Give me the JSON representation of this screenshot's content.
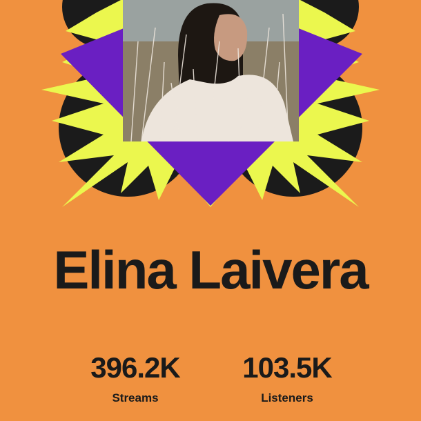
{
  "theme": {
    "background": "#F0913F",
    "text": "#1A1A1A",
    "burst_black": "#1B1B1B",
    "burst_yellow": "#EBF74E",
    "burst_purple": "#6A1FC2",
    "photo_sky": "#9AA2A0",
    "photo_field": "#8B7F67",
    "photo_dress": "#EDE5DC",
    "photo_hair": "#1D1712",
    "photo_skin": "#C79A80"
  },
  "artist": {
    "name": "Elina Laivera",
    "photo_icon": "artist-photo"
  },
  "stats": [
    {
      "value": "396.2K",
      "label": "Streams"
    },
    {
      "value": "103.5K",
      "label": "Listeners"
    }
  ]
}
